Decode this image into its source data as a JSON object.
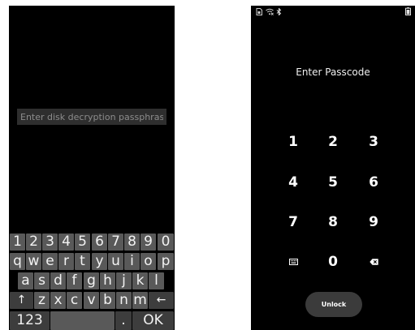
{
  "left": {
    "placeholder": "Enter disk decryption passphrase",
    "keyboard": {
      "row1": [
        "1",
        "2",
        "3",
        "4",
        "5",
        "6",
        "7",
        "8",
        "9",
        "0"
      ],
      "row2": [
        "q",
        "w",
        "e",
        "r",
        "t",
        "y",
        "u",
        "i",
        "o",
        "p"
      ],
      "row3": [
        "a",
        "s",
        "d",
        "f",
        "g",
        "h",
        "j",
        "k",
        "l"
      ],
      "row4": {
        "shift": "↑",
        "letters": [
          "z",
          "x",
          "c",
          "v",
          "b",
          "n",
          "m"
        ],
        "backspace": "←"
      },
      "row5": {
        "numbers": "123",
        "space": "",
        "period": ".",
        "ok": "OK"
      }
    }
  },
  "right": {
    "status_icons": [
      "sim-icon",
      "wifi-icon",
      "bluetooth-icon",
      "battery-icon"
    ],
    "title": "Enter Passcode",
    "keypad": {
      "row1": [
        "1",
        "2",
        "3"
      ],
      "row2": [
        "4",
        "5",
        "6"
      ],
      "row3": [
        "7",
        "8",
        "9"
      ],
      "row4": {
        "left_icon": "keyboard-icon",
        "middle": "0",
        "right_icon": "backspace-icon"
      }
    },
    "unlock_label": "Unlock"
  }
}
